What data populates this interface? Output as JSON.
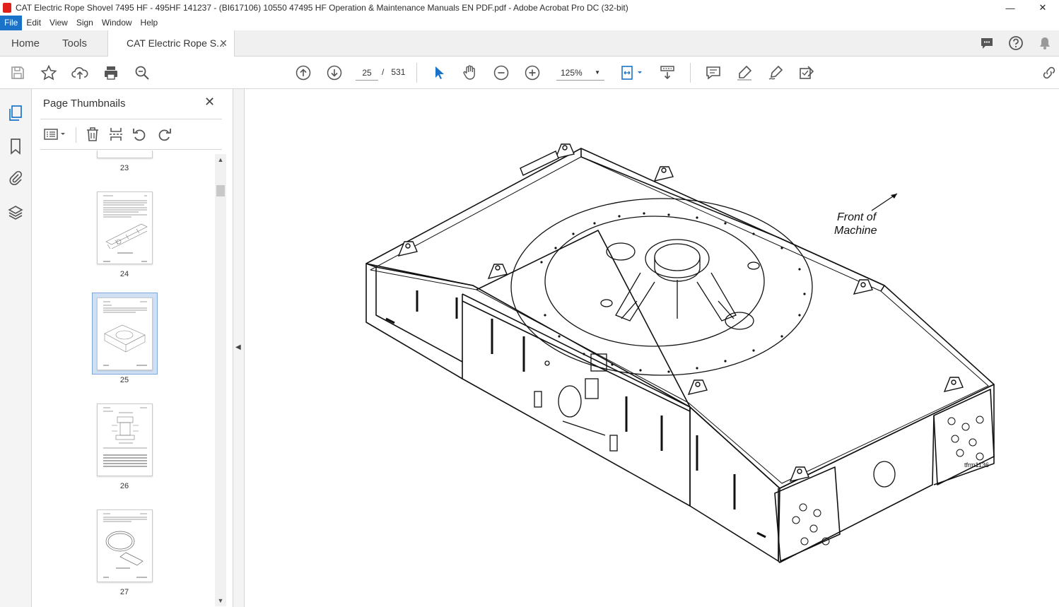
{
  "window": {
    "title": "CAT Electric Rope Shovel 7495 HF - 495HF 141237 - (BI617106) 10550 47495 HF Operation & Maintenance Manuals EN PDF.pdf - Adobe Acrobat Pro DC (32-bit)",
    "minimize": "—",
    "close": "✕"
  },
  "menu": [
    "File",
    "Edit",
    "View",
    "Sign",
    "Window",
    "Help"
  ],
  "tabs": {
    "home": "Home",
    "tools": "Tools",
    "document": "CAT Electric Rope S...",
    "document_close": "✕"
  },
  "toolbar": {
    "page_current": "25",
    "page_separator": "/",
    "page_total": "531",
    "zoom": "125%"
  },
  "side_panel": {
    "title": "Page Thumbnails",
    "close": "✕",
    "thumbnails": [
      {
        "label": "23"
      },
      {
        "label": "24"
      },
      {
        "label": "25",
        "selected": true
      },
      {
        "label": "26"
      },
      {
        "label": "27"
      }
    ]
  },
  "document": {
    "annotation_front": "Front of\nMachine",
    "figure_id": "tfrm1136"
  },
  "colors": {
    "accent": "#1a73c9",
    "selection": "#cfe0f5",
    "pdf_red": "#e0201b"
  }
}
